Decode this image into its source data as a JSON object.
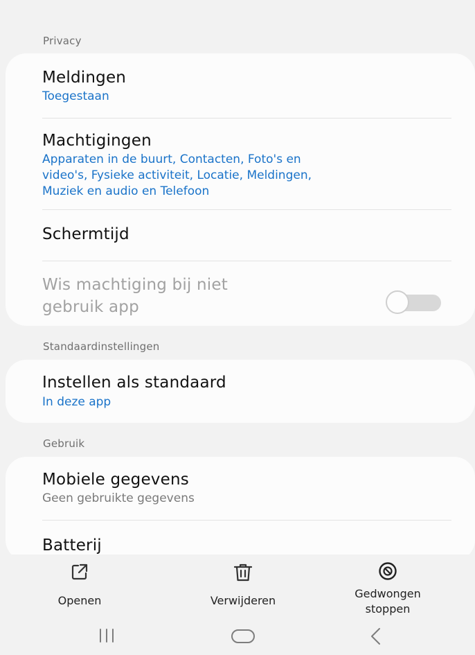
{
  "sections": {
    "privacy": "Privacy",
    "defaults": "Standaardinstellingen",
    "usage": "Gebruik"
  },
  "privacy": {
    "notifications": {
      "title": "Meldingen",
      "value": "Toegestaan"
    },
    "permissions": {
      "title": "Machtigingen",
      "value_lines": [
        "Apparaten in de buurt, Contacten, Foto's en",
        "video's, Fysieke activiteit, Locatie, Meldingen,",
        "Muziek en audio en Telefoon"
      ]
    },
    "screentime": {
      "title": "Schermtijd"
    },
    "remove_permissions": {
      "title_lines": [
        "Wis machtiging bij niet",
        "gebruik app"
      ],
      "toggle_on": false
    }
  },
  "defaults": {
    "set_default": {
      "title": "Instellen als standaard",
      "value": "In deze app"
    }
  },
  "usage": {
    "mobile_data": {
      "title": "Mobiele gegevens",
      "value": "Geen gebruikte gegevens"
    },
    "battery": {
      "title": "Batterij"
    }
  },
  "actions": {
    "open": {
      "label": "Openen",
      "icon": "open-external-icon"
    },
    "delete": {
      "label": "Verwijderen",
      "icon": "trash-icon"
    },
    "force_stop": {
      "label_lines": [
        "Gedwongen",
        "stoppen"
      ],
      "icon": "force-stop-icon"
    }
  },
  "nav": {
    "recents": "recents-icon",
    "home": "home-icon",
    "back": "back-icon"
  },
  "colors": {
    "accent": "#1a73c9",
    "background": "#f2f2f2",
    "card": "#fcfcfc"
  }
}
